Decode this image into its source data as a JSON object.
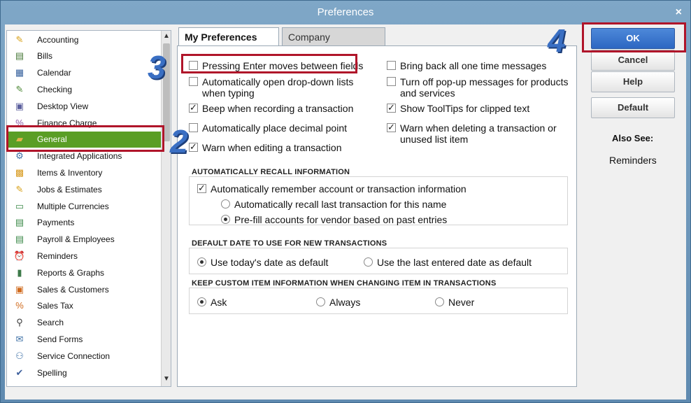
{
  "window": {
    "title": "Preferences",
    "close_glyph": "×"
  },
  "categories": [
    {
      "label": "Accounting",
      "icon": "accounting-icon",
      "glyph": "✎",
      "color": "#d9a21b"
    },
    {
      "label": "Bills",
      "icon": "bills-icon",
      "glyph": "▤",
      "color": "#4a7a3a"
    },
    {
      "label": "Calendar",
      "icon": "calendar-icon",
      "glyph": "▦",
      "color": "#345f9c"
    },
    {
      "label": "Checking",
      "icon": "checking-icon",
      "glyph": "✎",
      "color": "#4f8a39"
    },
    {
      "label": "Desktop View",
      "icon": "desktop-view-icon",
      "glyph": "▣",
      "color": "#5b5f9d"
    },
    {
      "label": "Finance Charge",
      "icon": "finance-charge-icon",
      "glyph": "%",
      "color": "#8b5aa7"
    },
    {
      "label": "General",
      "icon": "general-icon",
      "glyph": "▰",
      "color": "#e3b24b",
      "selected": true
    },
    {
      "label": "Integrated Applications",
      "icon": "integrated-apps-icon",
      "glyph": "⚙",
      "color": "#3d70a6"
    },
    {
      "label": "Items & Inventory",
      "icon": "items-inventory-icon",
      "glyph": "▩",
      "color": "#d89a1e"
    },
    {
      "label": "Jobs & Estimates",
      "icon": "jobs-estimates-icon",
      "glyph": "✎",
      "color": "#d9a21b"
    },
    {
      "label": "Multiple Currencies",
      "icon": "multiple-currencies-icon",
      "glyph": "▭",
      "color": "#3d8a4a"
    },
    {
      "label": "Payments",
      "icon": "payments-icon",
      "glyph": "▤",
      "color": "#3d8a4a"
    },
    {
      "label": "Payroll & Employees",
      "icon": "payroll-employees-icon",
      "glyph": "▤",
      "color": "#3d8a4a"
    },
    {
      "label": "Reminders",
      "icon": "reminders-icon",
      "glyph": "⏰",
      "color": "#d98d1e"
    },
    {
      "label": "Reports & Graphs",
      "icon": "reports-graphs-icon",
      "glyph": "▮",
      "color": "#3d7a4a"
    },
    {
      "label": "Sales & Customers",
      "icon": "sales-customers-icon",
      "glyph": "▣",
      "color": "#d06b1e"
    },
    {
      "label": "Sales Tax",
      "icon": "sales-tax-icon",
      "glyph": "%",
      "color": "#d06b1e"
    },
    {
      "label": "Search",
      "icon": "search-icon",
      "glyph": "⚲",
      "color": "#3b3b3b"
    },
    {
      "label": "Send Forms",
      "icon": "send-forms-icon",
      "glyph": "✉",
      "color": "#3d70a6"
    },
    {
      "label": "Service Connection",
      "icon": "service-connection-icon",
      "glyph": "⚇",
      "color": "#3d70a6"
    },
    {
      "label": "Spelling",
      "icon": "spelling-icon",
      "glyph": "✔",
      "color": "#3d5f9c"
    }
  ],
  "tabs": {
    "my": "My Preferences",
    "company": "Company Preferences"
  },
  "my_prefs": {
    "left": [
      {
        "label": "Pressing Enter moves between fields",
        "checked": false
      },
      {
        "label": "Automatically open drop-down lists when typing",
        "checked": false
      },
      {
        "label": "Beep when recording a transaction",
        "checked": true
      },
      {
        "label": "Automatically place decimal point",
        "checked": false
      },
      {
        "label": "Warn when editing a transaction",
        "checked": true
      }
    ],
    "right": [
      {
        "label": "Bring back all one time messages",
        "checked": false
      },
      {
        "label": "Turn off pop-up messages for products and services",
        "checked": false
      },
      {
        "label": "Show ToolTips for clipped text",
        "checked": true
      },
      {
        "label": "Warn when deleting a transaction or unused list item",
        "checked": true
      }
    ],
    "recall": {
      "heading": "AUTOMATICALLY RECALL INFORMATION",
      "main": {
        "label": "Automatically remember account or transaction information",
        "checked": true
      },
      "options": [
        {
          "label": "Automatically recall last transaction for this name",
          "selected": false
        },
        {
          "label": "Pre-fill accounts for vendor based on past entries",
          "selected": true
        }
      ]
    },
    "default_date": {
      "heading": "DEFAULT DATE TO USE FOR NEW TRANSACTIONS",
      "options": [
        {
          "label": "Use today's date as default",
          "selected": true
        },
        {
          "label": "Use the last entered date as default",
          "selected": false
        }
      ]
    },
    "custom_item": {
      "heading": "KEEP CUSTOM ITEM INFORMATION WHEN CHANGING ITEM IN TRANSACTIONS",
      "options": [
        {
          "label": "Ask",
          "selected": true
        },
        {
          "label": "Always",
          "selected": false
        },
        {
          "label": "Never",
          "selected": false
        }
      ]
    }
  },
  "buttons": {
    "ok": "OK",
    "cancel": "Cancel",
    "help": "Help",
    "default": "Default"
  },
  "also_see": {
    "heading": "Also See:",
    "link": "Reminders"
  },
  "annotations": {
    "step2": "2",
    "step3": "3",
    "step4": "4"
  }
}
